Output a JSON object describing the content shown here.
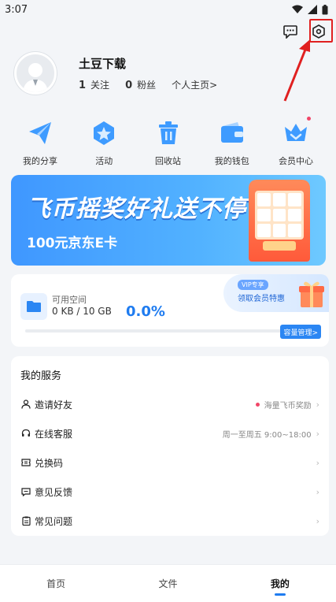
{
  "status_bar": {
    "time": "3:07"
  },
  "profile": {
    "username": "土豆下载",
    "following_count": "1",
    "following_label": "关注",
    "followers_count": "0",
    "followers_label": "粉丝",
    "homepage_link": "个人主页>"
  },
  "quick_menu": [
    {
      "label": "我的分享",
      "icon": "paper-plane-icon"
    },
    {
      "label": "活动",
      "icon": "star-badge-icon"
    },
    {
      "label": "回收站",
      "icon": "trash-icon"
    },
    {
      "label": "我的钱包",
      "icon": "wallet-icon"
    },
    {
      "label": "会员中心",
      "icon": "crown-icon"
    }
  ],
  "banner": {
    "title": "飞币摇奖好礼送不停",
    "subtitle": "100元京东E卡"
  },
  "storage": {
    "label": "可用空间",
    "amount": "0 KB / 10 GB",
    "percent": "0.0%",
    "percent_value": 0.0,
    "manage_button": "容量管理>",
    "vip_tag": "VIP专享",
    "vip_text": "领取会员特惠"
  },
  "services": {
    "title": "我的服务",
    "items": [
      {
        "label": "邀请好友",
        "meta": "海量飞币奖励",
        "icon": "person-icon"
      },
      {
        "label": "在线客服",
        "meta": "周一至周五 9:00~18:00",
        "icon": "headset-icon"
      },
      {
        "label": "兑换码",
        "meta": "",
        "icon": "ticket-icon"
      },
      {
        "label": "意见反馈",
        "meta": "",
        "icon": "feedback-icon"
      },
      {
        "label": "常见问题",
        "meta": "",
        "icon": "clipboard-icon"
      }
    ]
  },
  "tabs": [
    {
      "label": "首页"
    },
    {
      "label": "文件"
    },
    {
      "label": "我的"
    }
  ],
  "colors": {
    "accent": "#1f7cf0",
    "highlight": "#e02020"
  }
}
